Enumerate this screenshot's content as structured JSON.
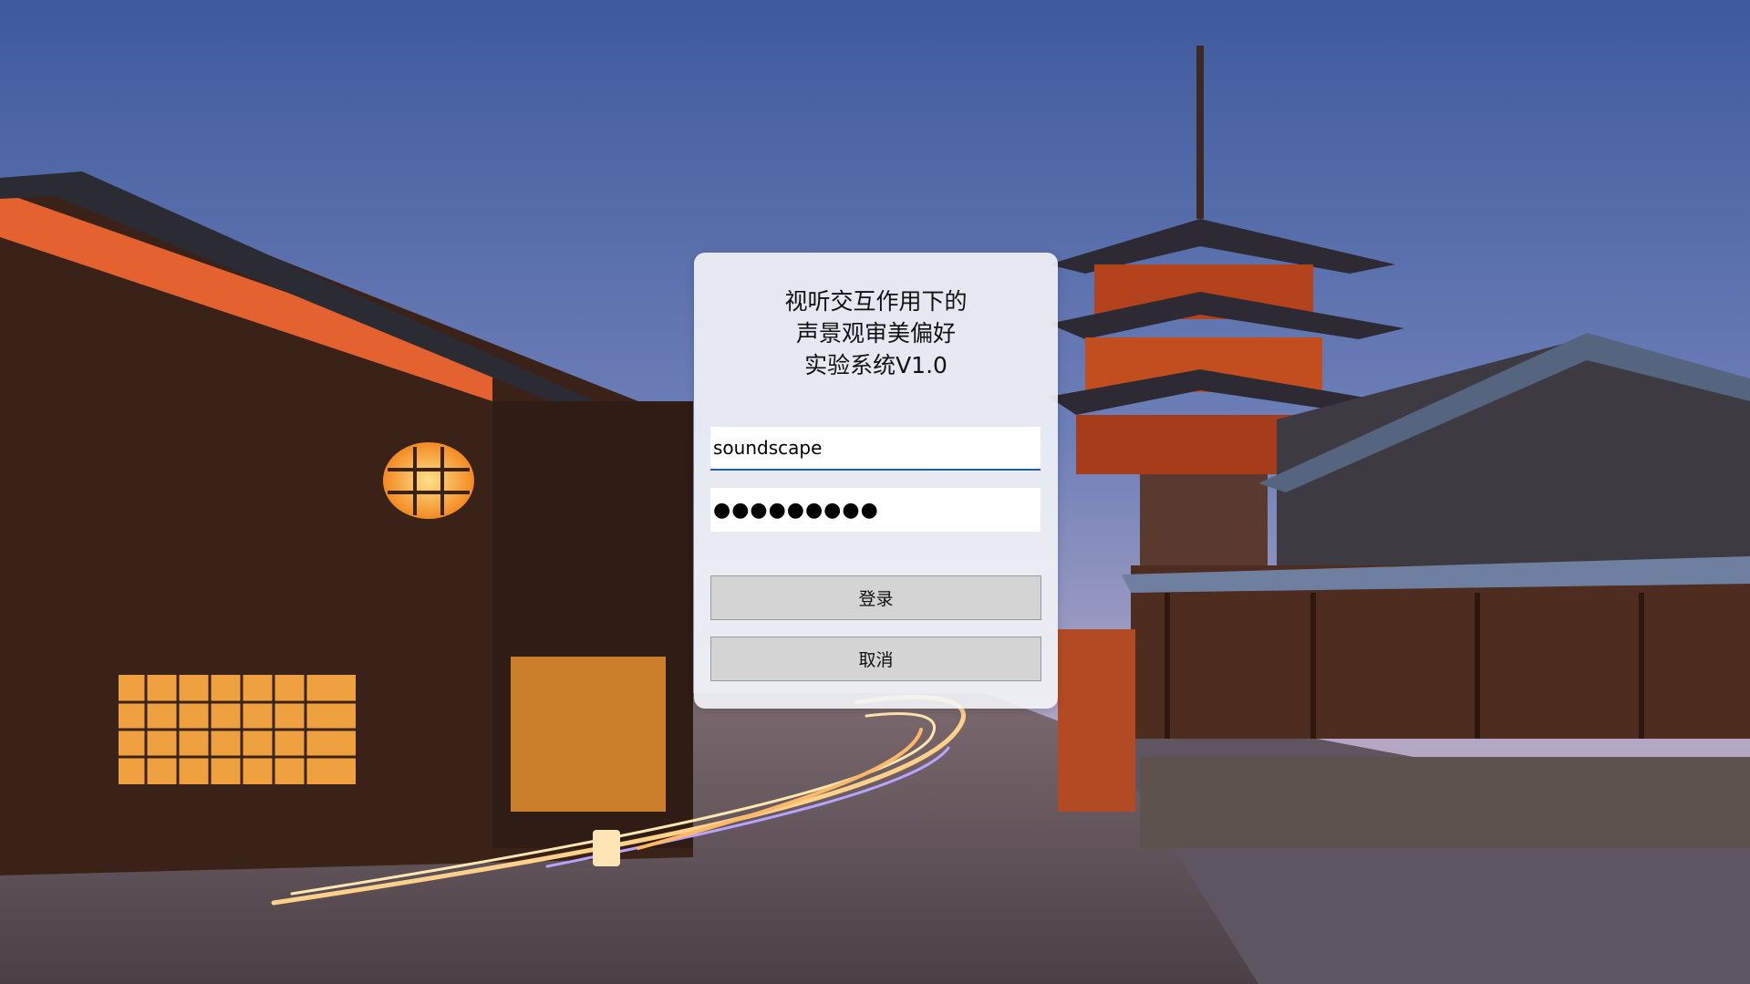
{
  "login": {
    "title_lines": [
      "视听交互作用下的",
      "声景观审美偏好",
      "实验系统V1.0"
    ],
    "username_value": "soundscape",
    "password_value": "●●●●●●●●●",
    "login_label": "登录",
    "cancel_label": "取消"
  },
  "colors": {
    "sky_top": "#4f6aa8",
    "sky_bottom": "#9aa3c9",
    "pagoda": "#b4421c",
    "lantern_glow": "#ffb347",
    "input_underline": "#1f5fa8",
    "button_bg": "#d4d4d4"
  }
}
